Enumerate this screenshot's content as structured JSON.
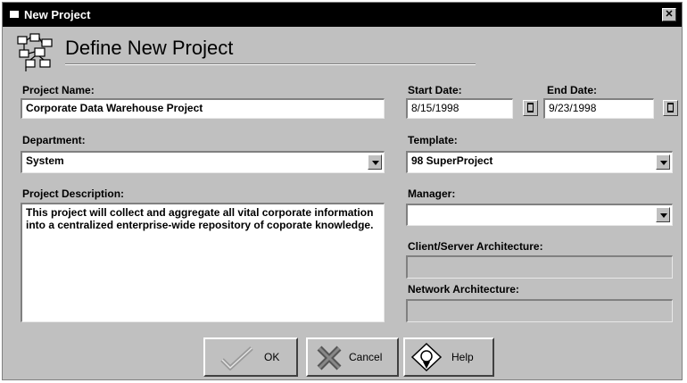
{
  "window": {
    "title": "New Project",
    "close_glyph": "✕"
  },
  "header": {
    "title": "Define New Project",
    "icon": "network-icon"
  },
  "form": {
    "project_name": {
      "label": "Project Name:",
      "value": "Corporate Data Warehouse Project"
    },
    "start_date": {
      "label": "Start Date:",
      "value": "8/15/1998"
    },
    "end_date": {
      "label": "End Date:",
      "value": "9/23/1998"
    },
    "department": {
      "label": "Department:",
      "value": "System"
    },
    "template": {
      "label": "Template:",
      "value": "98 SuperProject"
    },
    "description": {
      "label": "Project Description:",
      "value": "This project will collect and aggregate all vital corporate information into a centralized enterprise-wide repository of coporate knowledge."
    },
    "manager": {
      "label": "Manager:",
      "value": ""
    },
    "client_server": {
      "label": "Client/Server Architecture:",
      "value": ""
    },
    "network": {
      "label": "Network Architecture:",
      "value": ""
    }
  },
  "buttons": {
    "ok": {
      "label": "OK",
      "icon": "checkmark-icon"
    },
    "cancel": {
      "label": "Cancel",
      "icon": "x-mark-icon"
    },
    "help": {
      "label": "Help",
      "icon": "help-icon"
    }
  }
}
